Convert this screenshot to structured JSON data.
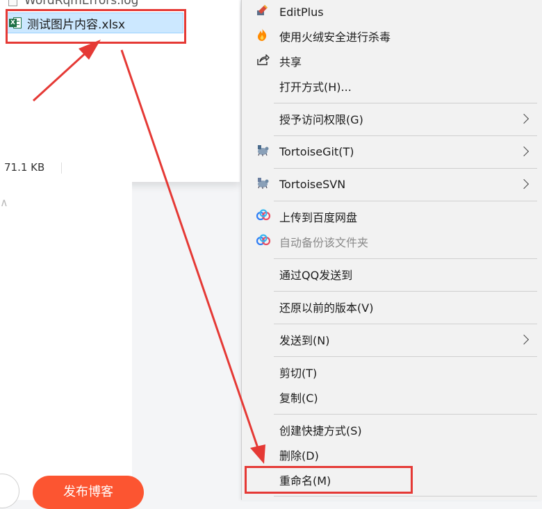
{
  "explorer": {
    "partial_file": "WordRqmErrors.log",
    "selected_file": "测试图片内容.xlsx",
    "selected_file_icon": "excel-file-icon",
    "status_size": "71.1 KB"
  },
  "blog": {
    "publish_label": "发布博客"
  },
  "context_menu": {
    "editplus": "EditPlus",
    "antivirus": "使用火绒安全进行杀毒",
    "share": "共享",
    "open_with": "打开方式(H)...",
    "grant_access": "授予访问权限(G)",
    "tortoise_git": "TortoiseGit(T)",
    "tortoise_svn": "TortoiseSVN",
    "upload_baidu": "上传到百度网盘",
    "auto_backup": "自动备份该文件夹",
    "send_qq": "通过QQ发送到",
    "restore_version": "还原以前的版本(V)",
    "send_to": "发送到(N)",
    "cut": "剪切(T)",
    "copy": "复制(C)",
    "create_shortcut": "创建快捷方式(S)",
    "delete": "删除(D)",
    "rename": "重命名(M)"
  },
  "colors": {
    "highlight": "#e53935",
    "selection": "#cce8ff",
    "publish": "#fc5531",
    "menu_bg": "#f2f2f2"
  }
}
